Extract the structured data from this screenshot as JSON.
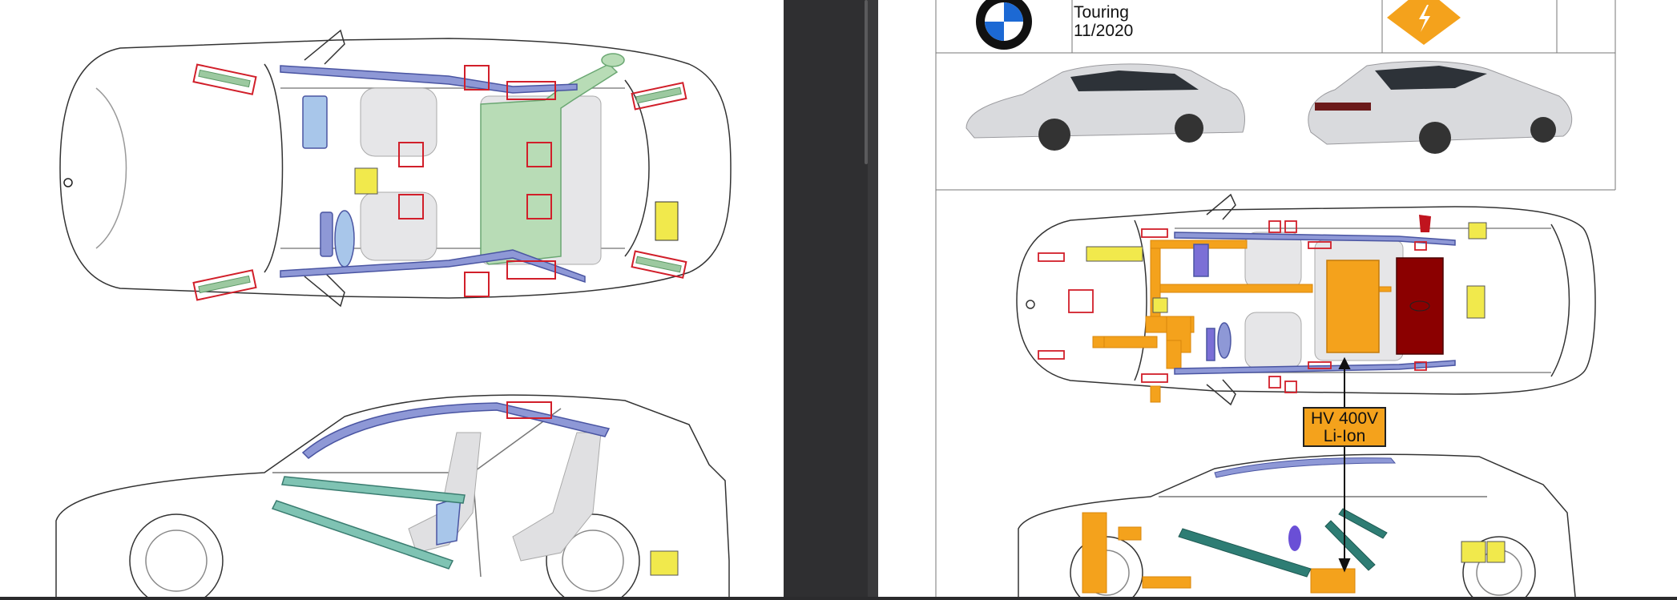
{
  "window": {
    "left_document": "rescue-sheet-hatchback",
    "right_document": "rescue-sheet-touring"
  },
  "vehicle": {
    "model_line": "Touring",
    "date": "11/2020",
    "hv_voltage": "HV 400V",
    "hv_type": "Li-Ion"
  },
  "icons": {
    "brand_logo": "bmw-logo-icon",
    "hv_warning": "high-voltage-warning-icon"
  },
  "colors": {
    "airbag_blue": "#7b86c9",
    "seatbelt_green": "#9cc9a0",
    "gas_yellow": "#f1e94c",
    "marker_red": "#d11f2a",
    "hv_orange": "#f4a21c",
    "battery_red": "#8b0000",
    "reinforce_teal": "#2e7d74"
  }
}
